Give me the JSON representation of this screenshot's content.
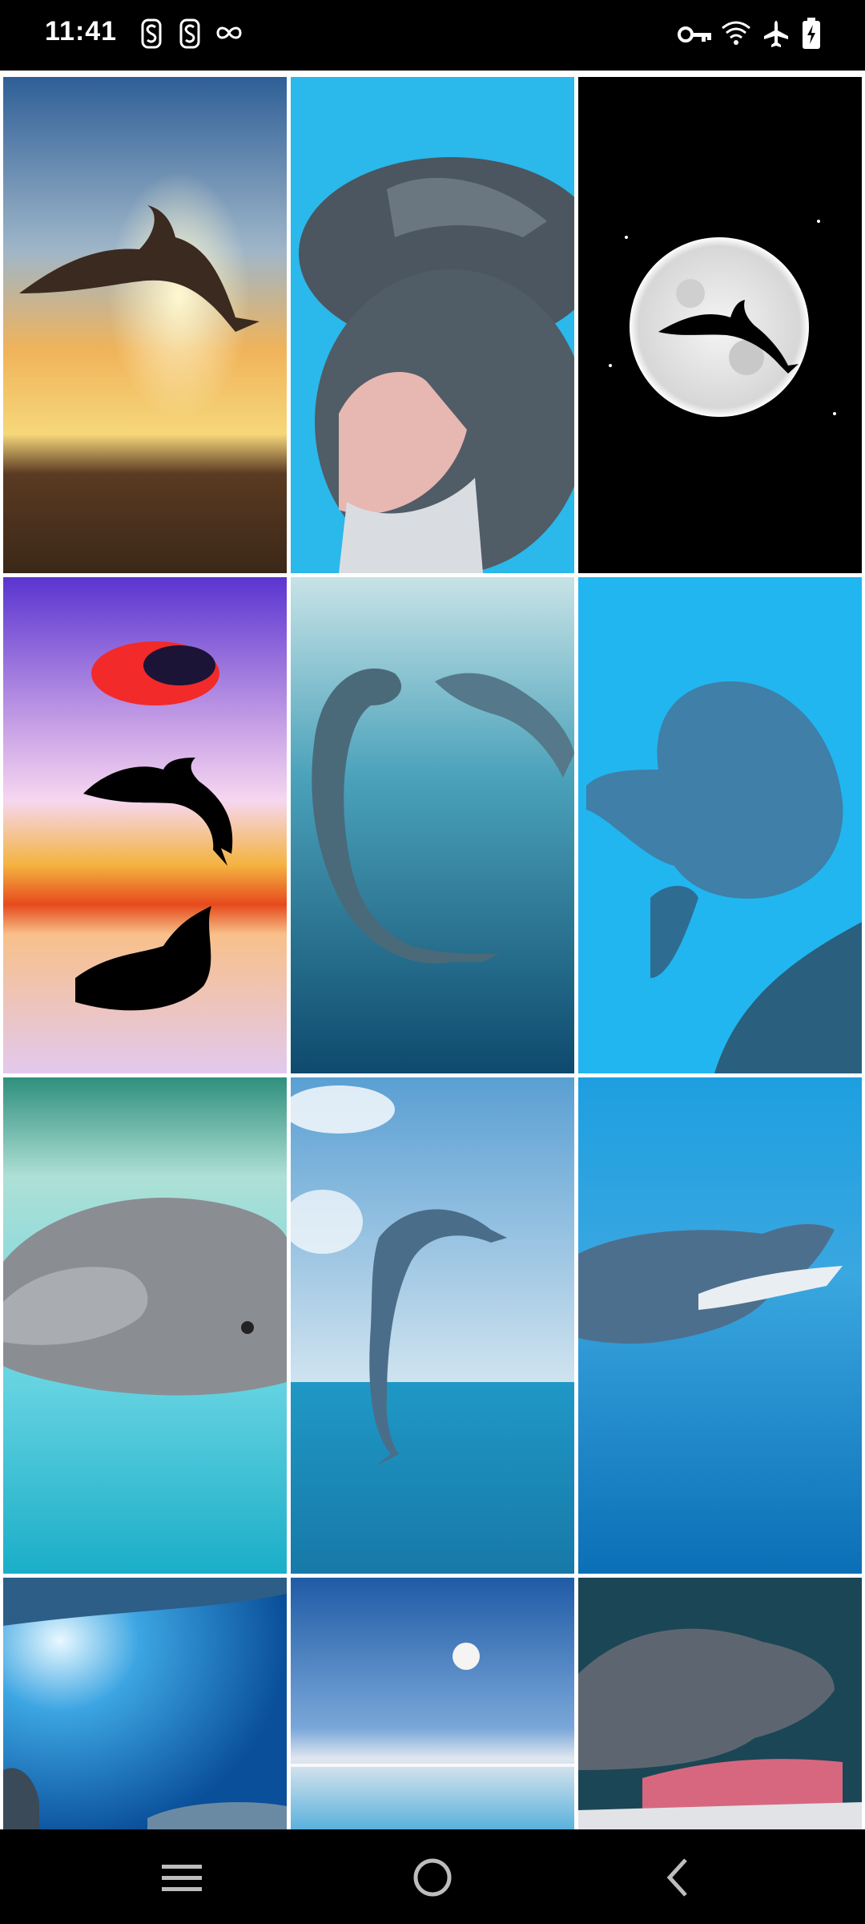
{
  "status_bar": {
    "time": "11:41",
    "left_icons": [
      "notification-s-icon",
      "notification-s-icon",
      "infinity-icon"
    ],
    "right_icons": [
      "vpn-key-icon",
      "wifi-icon",
      "airplane-mode-icon",
      "battery-charging-icon"
    ]
  },
  "gallery": {
    "columns": 3,
    "wallpapers": [
      {
        "name": "dolphin-sunset-jump"
      },
      {
        "name": "two-dolphins-smiling"
      },
      {
        "name": "dolphin-moon-silhouette"
      },
      {
        "name": "dolphin-silhouette-sunset-reflection"
      },
      {
        "name": "dolphins-underwater-kiss"
      },
      {
        "name": "dolphin-underwater-blue"
      },
      {
        "name": "dolphins-at-surface"
      },
      {
        "name": "dolphin-leaping-sky"
      },
      {
        "name": "dolphin-open-mouth-water"
      },
      {
        "name": "underwater-light-rays"
      },
      {
        "name": "moon-over-sea"
      },
      {
        "name": "dolphin-close-up-smile"
      }
    ]
  },
  "nav_bar": {
    "buttons": [
      "menu-icon",
      "home-icon",
      "back-icon"
    ]
  },
  "colors": {
    "status_bar_bg": "#000000",
    "nav_bar_bg": "#000000",
    "grid_gap": "#ffffff"
  }
}
